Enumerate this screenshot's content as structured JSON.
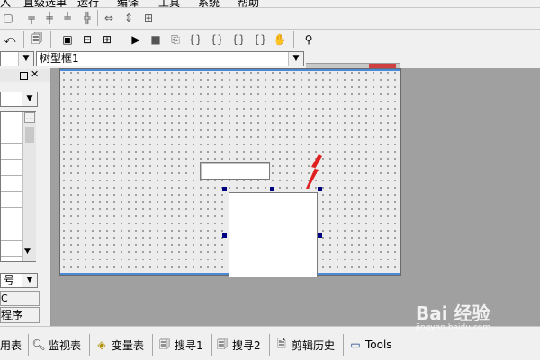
{
  "menubar": {
    "items": [
      "入",
      "直级选单",
      "运行",
      "编译",
      "工具",
      "系统",
      "帮助"
    ]
  },
  "toolbar2": {
    "icons": [
      "undo-icon",
      "find-icon",
      "window-icon",
      "split-horizontal-icon",
      "split-window-icon",
      "run-icon",
      "stop-icon",
      "step-icon",
      "step-into-icon",
      "step-out-icon",
      "run-to-cursor-icon",
      "breakpoint-icon",
      "hand-icon",
      "binoculars-icon"
    ]
  },
  "combo": {
    "left_value": "",
    "right_value": "树型框1"
  },
  "panel": {
    "list_header_btn": "…",
    "tab_partial_1": "C",
    "tab_partial_2": "程序",
    "combo_partial": "号"
  },
  "bottom_tabs": [
    {
      "label": "用表",
      "icon": "table-icon"
    },
    {
      "label": "监视表",
      "icon": "magnifier-icon"
    },
    {
      "label": "变量表",
      "icon": "variables-icon"
    },
    {
      "label": "搜寻1",
      "icon": "search-window-icon"
    },
    {
      "label": "搜寻2",
      "icon": "search-window-icon"
    },
    {
      "label": "剪辑历史",
      "icon": "clipboard-icon"
    },
    {
      "label": "Tools",
      "icon": "window-icon"
    }
  ],
  "watermark": {
    "text": "Bai 经验",
    "sub": "jingyan.baidu.com"
  },
  "colors": {
    "selection_handle": "#000080",
    "arrow": "#e02020",
    "title_accent": "#4a8ad8"
  }
}
